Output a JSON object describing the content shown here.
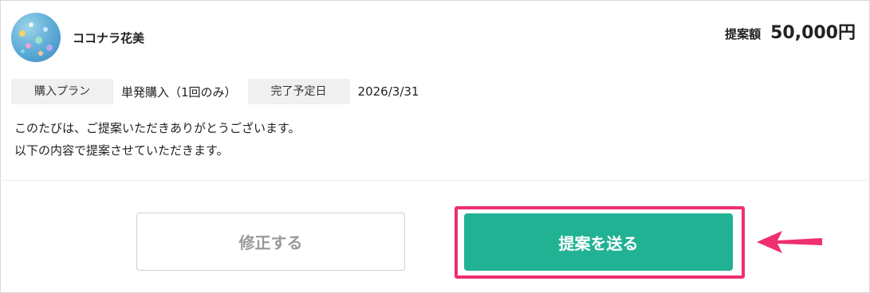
{
  "seller": {
    "name": "ココナラ花美"
  },
  "price": {
    "label": "提案額",
    "value": "50,000円"
  },
  "info": {
    "plan_label": "購入プラン",
    "plan_value": "単発購入（1回のみ）",
    "due_label": "完了予定日",
    "due_value": "2026/3/31"
  },
  "message": {
    "line1": "このたびは、ご提案いただきありがとうございます。",
    "line2": "以下の内容で提案させていただきます。"
  },
  "actions": {
    "edit_label": "修正する",
    "send_label": "提案を送る"
  },
  "colors": {
    "send_button": "#21b294",
    "highlight": "#ee2f72",
    "arrow": "#ee2f72"
  },
  "icons": {
    "callout_arrow": "left-arrow-icon"
  }
}
